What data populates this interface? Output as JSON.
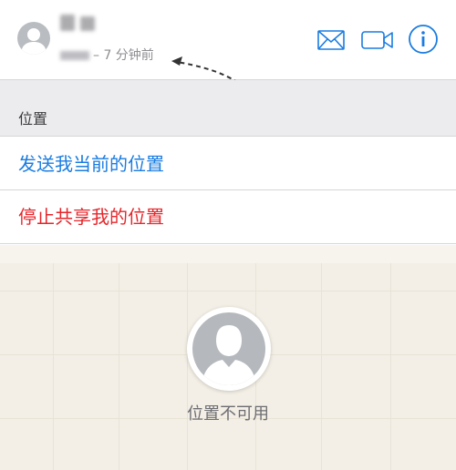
{
  "header": {
    "time_text": "– 7 分钟前",
    "actions": {
      "mail_icon": "mail-icon",
      "video_icon": "video-camera-icon",
      "info_icon": "info-icon"
    }
  },
  "location_section": {
    "title": "位置",
    "send_label": "发送我当前的位置",
    "stop_label": "停止共享我的位置"
  },
  "map": {
    "status_text": "位置不可用"
  },
  "colors": {
    "accent_blue": "#1a7ce0",
    "destructive_red": "#e5262b",
    "map_background": "#f3efe6"
  }
}
